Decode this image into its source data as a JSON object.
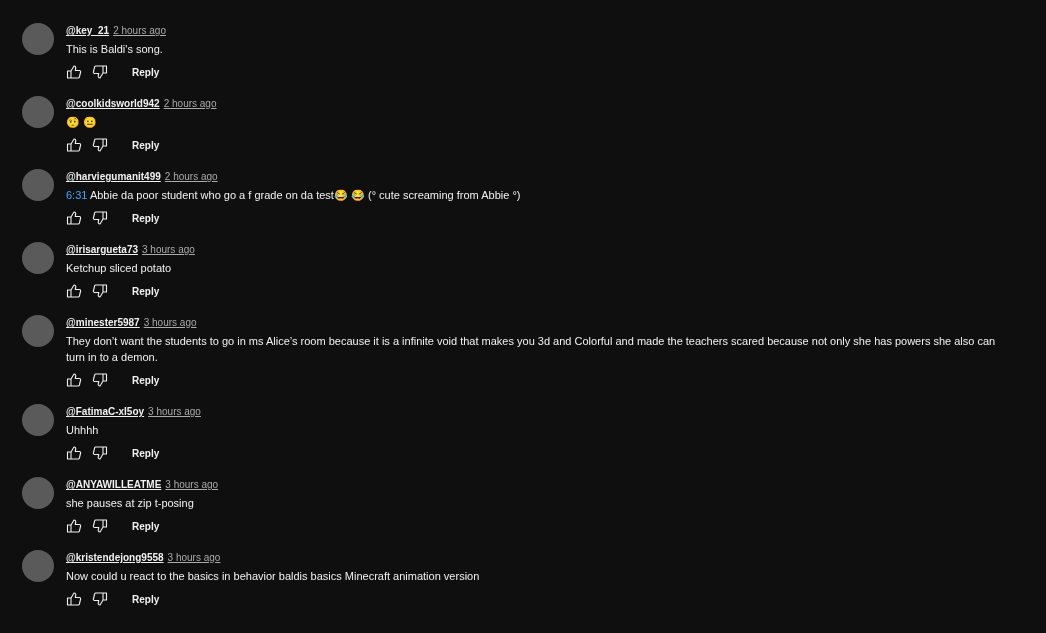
{
  "comments": [
    {
      "author": "@key_21",
      "time": "2 hours ago",
      "text": "This is Baldi's song.",
      "reply": "Reply"
    },
    {
      "author": "@coolkidsworld942",
      "time": "2 hours ago",
      "text": "🤨 😐",
      "reply": "Reply"
    },
    {
      "author": "@harviegumanit499",
      "time": "2 hours ago",
      "timestamp_link": "6:31",
      "text": "Abbie da poor student who go a f grade on da test😂 😂  (° cute screaming from Abbie °)",
      "reply": "Reply"
    },
    {
      "author": "@irisargueta73",
      "time": "3 hours ago",
      "text": "Ketchup sliced potato",
      "reply": "Reply"
    },
    {
      "author": "@minester5987",
      "time": "3 hours ago",
      "text": "They don’t want the students to go in ms Alice’s room because it is a  infinite void that makes you 3d and Colorful and made the teachers scared because not only she has powers she also can turn in to a demon.",
      "reply": "Reply"
    },
    {
      "author": "@FatimaC-xl5oy",
      "time": "3 hours ago",
      "text": "Uhhhh",
      "reply": "Reply"
    },
    {
      "author": "@ANYAWILLEATME",
      "time": "3 hours ago",
      "text": "she pauses at zip t-posing",
      "reply": "Reply"
    },
    {
      "author": "@kristendejong9558",
      "time": "3 hours ago",
      "text": "Now could u react to the basics in behavior baldis basics Minecraft animation version",
      "reply": "Reply"
    }
  ]
}
